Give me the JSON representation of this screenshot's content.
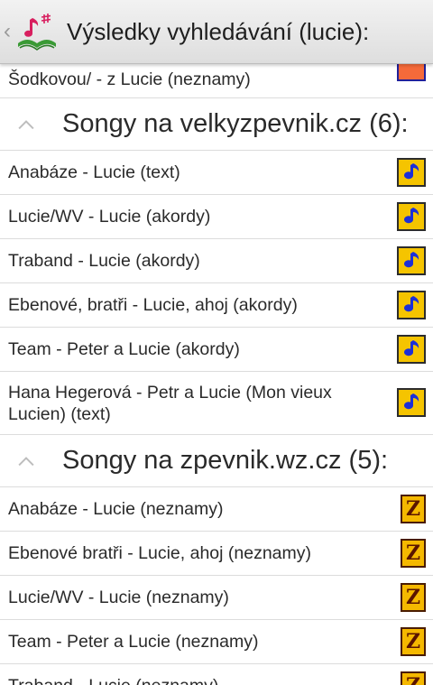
{
  "header": {
    "title": "Výsledky vyhledávání (lucie):"
  },
  "partial_row": {
    "label": "Šodkovou/ - z Lucie (neznamy)"
  },
  "sections": [
    {
      "title": "Songy na velkyzpevnik.cz (6):",
      "icon": "music-note-icon",
      "items": [
        "Anabáze - Lucie (text)",
        "Lucie/WV - Lucie (akordy)",
        "Traband - Lucie (akordy)",
        "Ebenové, bratři - Lucie, ahoj (akordy)",
        "Team - Peter a Lucie (akordy)",
        "Hana Hegerová - Petr a Lucie (Mon vieux Lucien) (text)"
      ]
    },
    {
      "title": "Songy na zpevnik.wz.cz (5):",
      "icon": "z-letter-icon",
      "items": [
        "Anabáze - Lucie (neznamy)",
        "Ebenové bratři - Lucie, ahoj (neznamy)",
        "Lucie/WV - Lucie (neznamy)",
        "Team - Peter a Lucie (neznamy)",
        "Traband - Lucie (neznamy)"
      ]
    }
  ],
  "icons": {
    "z_letter": "Z"
  },
  "colors": {
    "note_bg": "#f5c400",
    "note_fg": "#1c2fd8",
    "z_bg": "#f5b800",
    "z_fg": "#5a1400"
  }
}
